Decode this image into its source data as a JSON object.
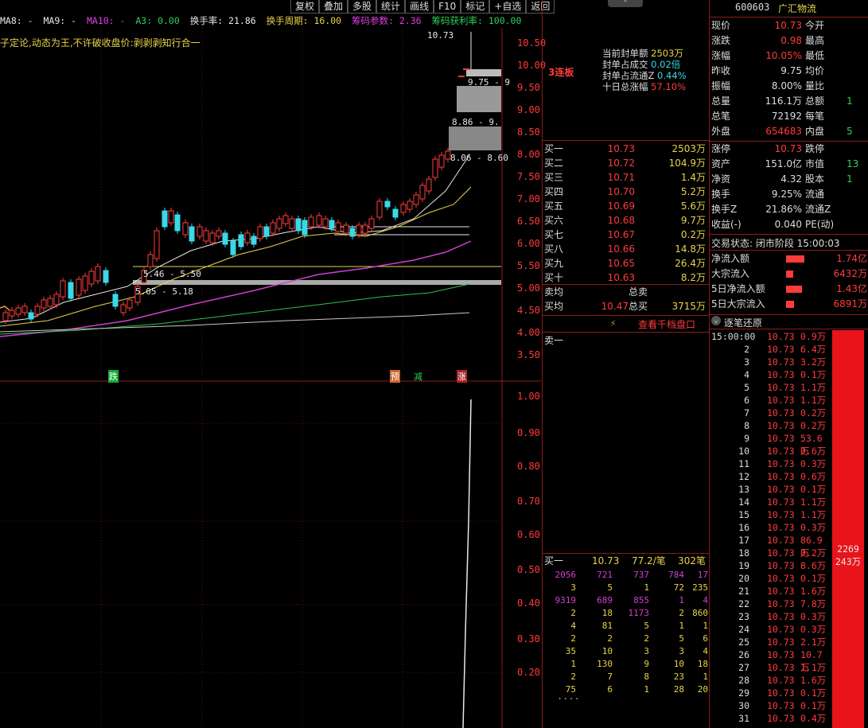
{
  "toolbar": [
    "复权",
    "叠加",
    "多股",
    "统计",
    "画线",
    "F10",
    "标记",
    "+自选",
    "返回"
  ],
  "indicator_bar": {
    "ma8": "MA8: -",
    "ma9": "MA9: -",
    "ma10": "MA10: -",
    "a3": "A3: 0.00",
    "turnover": "换手率: 21.86",
    "turnover_cycle": "换手周期: 16.00",
    "chip_param": "筹码参数: 2.36",
    "chip_profit": "筹码获利率: 100.00"
  },
  "motto": "子定论,动态为王,不许破收盘价:剥剥剥知行合一",
  "colors": {
    "up": "#ff3b3b",
    "down": "#38d9e8",
    "grid": "#8b1b1b"
  },
  "kline_axis": [
    "10.50",
    "10.00",
    "9.50",
    "9.00",
    "8.50",
    "8.00",
    "7.50",
    "7.00",
    "6.50",
    "6.00",
    "5.50",
    "5.00",
    "4.50",
    "4.00",
    "3.50"
  ],
  "price_labels": {
    "high": "10.73",
    "gap1": "9.75 - 9",
    "gap2": "8.86 - 9.",
    "gap3": "8.06 - 8.60",
    "zone1": "5.46 - 5.50",
    "zone2": "5.05 - 5.18"
  },
  "signals": {
    "die": "跌",
    "yu": "预",
    "jian": "减",
    "zhang": "涨"
  },
  "sub_axis": [
    "1.00",
    "0.90",
    "0.80",
    "0.70",
    "0.60",
    "0.50",
    "0.40",
    "0.30",
    "0.20"
  ],
  "center": {
    "streak": "3连板",
    "seal": [
      {
        "label": "当前封单额",
        "value": "2503万"
      },
      {
        "label": "封单占成交",
        "value": "0.02倍"
      },
      {
        "label": "封单占流通Z",
        "value": "0.44%"
      },
      {
        "label": "十日总涨幅",
        "value": "57.10%"
      }
    ],
    "bids": [
      {
        "name": "买一",
        "price": "10.73",
        "vol": "2503万"
      },
      {
        "name": "买二",
        "price": "10.72",
        "vol": "104.9万"
      },
      {
        "name": "买三",
        "price": "10.71",
        "vol": "1.4万"
      },
      {
        "name": "买四",
        "price": "10.70",
        "vol": "5.2万"
      },
      {
        "name": "买五",
        "price": "10.69",
        "vol": "5.6万"
      },
      {
        "name": "买六",
        "price": "10.68",
        "vol": "9.7万"
      },
      {
        "name": "买七",
        "price": "10.67",
        "vol": "0.2万"
      },
      {
        "name": "买八",
        "price": "10.66",
        "vol": "14.8万"
      },
      {
        "name": "买九",
        "price": "10.65",
        "vol": "26.4万"
      },
      {
        "name": "买十",
        "price": "10.63",
        "vol": "8.2万"
      }
    ],
    "sell_avg_label": "卖均",
    "total_sell_label": "总卖",
    "buy_avg_label": "买均",
    "buy_avg": "10.47",
    "total_buy_label": "总买",
    "total_buy": "3715万",
    "depth_button": "查看千档盘口",
    "sell1": "卖一",
    "buy1_row": {
      "label": "买一",
      "price": "10.73",
      "avg": "77.2/笔",
      "count": "302笔"
    },
    "queue": [
      [
        "2056",
        "721",
        "737",
        "784",
        "17"
      ],
      [
        "3",
        "5",
        "1",
        "72",
        "235"
      ],
      [
        "9319",
        "689",
        "855",
        "1",
        "4"
      ],
      [
        "2",
        "18",
        "1173",
        "2",
        "860"
      ],
      [
        "4",
        "81",
        "5",
        "1",
        "1"
      ],
      [
        "2",
        "2",
        "2",
        "5",
        "6"
      ],
      [
        "35",
        "10",
        "3",
        "3",
        "4"
      ],
      [
        "1",
        "130",
        "9",
        "10",
        "18"
      ],
      [
        "2",
        "7",
        "8",
        "23",
        "1"
      ],
      [
        "75",
        "6",
        "1",
        "28",
        "20"
      ]
    ],
    "more": "...."
  },
  "right": {
    "code": "600603",
    "name": "广汇物流",
    "quotes": [
      {
        "l1": "现价",
        "v1": "10.73",
        "l2": "今开",
        "v2": ""
      },
      {
        "l1": "涨跌",
        "v1": "0.98",
        "l2": "最高",
        "v2": ""
      },
      {
        "l1": "涨幅",
        "v1": "10.05%",
        "l2": "最低",
        "v2": ""
      },
      {
        "l1": "昨收",
        "v1": "9.75",
        "l2": "均价",
        "v2": ""
      },
      {
        "l1": "振幅",
        "v1": "8.00%",
        "l2": "量比",
        "v2": ""
      },
      {
        "l1": "总量",
        "v1": "116.1万",
        "l2": "总额",
        "v2": "1"
      },
      {
        "l1": "总笔",
        "v1": "72192",
        "l2": "每笔",
        "v2": ""
      },
      {
        "l1": "外盘",
        "v1": "654683",
        "l2": "内盘",
        "v2": "5"
      }
    ],
    "quotes2": [
      {
        "l1": "涨停",
        "v1": "10.73",
        "l2": "跌停",
        "v2": ""
      },
      {
        "l1": "资产",
        "v1": "151.0亿",
        "l2": "市值",
        "v2": "13"
      },
      {
        "l1": "净资",
        "v1": "4.32",
        "l2": "股本",
        "v2": "1"
      },
      {
        "l1": "换手",
        "v1": "9.25%",
        "l2": "流通",
        "v2": ""
      },
      {
        "l1": "换手Z",
        "v1": "21.86%",
        "l2": "流通Z",
        "v2": ""
      },
      {
        "l1": "收益(-)",
        "v1": "0.040",
        "l2": "PE(动)",
        "v2": ""
      }
    ],
    "trade_status": "交易状态: 闭市阶段 15:00:03",
    "flows": [
      {
        "label": "净流入额",
        "value": "1.74亿",
        "bar": 0.9
      },
      {
        "label": "大宗流入",
        "value": "6432万",
        "bar": 0.35
      },
      {
        "label": "5日净流入额",
        "value": "1.43亿",
        "bar": 0.75
      },
      {
        "label": "5日大宗流入",
        "value": "6891万",
        "bar": 0.38
      }
    ],
    "tick_title": "逐笔还原",
    "ticks": [
      {
        "t": "15:00:00",
        "p": "10.73",
        "a": "0.9万"
      },
      {
        "t": "2",
        "p": "10.73",
        "a": "6.4万"
      },
      {
        "t": "3",
        "p": "10.73",
        "a": "3.2万"
      },
      {
        "t": "4",
        "p": "10.73",
        "a": "0.1万"
      },
      {
        "t": "5",
        "p": "10.73",
        "a": "1.1万"
      },
      {
        "t": "6",
        "p": "10.73",
        "a": "1.1万"
      },
      {
        "t": "7",
        "p": "10.73",
        "a": "0.2万"
      },
      {
        "t": "8",
        "p": "10.73",
        "a": "0.2万"
      },
      {
        "t": "9",
        "p": "10.73",
        "a": "53.6万"
      },
      {
        "t": "10",
        "p": "10.73",
        "a": "0.6万"
      },
      {
        "t": "11",
        "p": "10.73",
        "a": "0.3万"
      },
      {
        "t": "12",
        "p": "10.73",
        "a": "0.6万"
      },
      {
        "t": "13",
        "p": "10.73",
        "a": "0.1万"
      },
      {
        "t": "14",
        "p": "10.73",
        "a": "1.1万"
      },
      {
        "t": "15",
        "p": "10.73",
        "a": "1.1万"
      },
      {
        "t": "16",
        "p": "10.73",
        "a": "0.3万"
      },
      {
        "t": "17",
        "p": "10.73",
        "a": "86.9万"
      },
      {
        "t": "18",
        "p": "10.73",
        "a": "0.2万"
      },
      {
        "t": "19",
        "p": "10.73",
        "a": "8.6万"
      },
      {
        "t": "20",
        "p": "10.73",
        "a": "0.1万"
      },
      {
        "t": "21",
        "p": "10.73",
        "a": "1.6万"
      },
      {
        "t": "22",
        "p": "10.73",
        "a": "7.8万"
      },
      {
        "t": "23",
        "p": "10.73",
        "a": "0.3万"
      },
      {
        "t": "24",
        "p": "10.73",
        "a": "0.3万"
      },
      {
        "t": "25",
        "p": "10.73",
        "a": "2.1万"
      },
      {
        "t": "26",
        "p": "10.73",
        "a": "10.7万"
      },
      {
        "t": "27",
        "p": "10.73",
        "a": "1.1万"
      },
      {
        "t": "28",
        "p": "10.73",
        "a": "1.6万"
      },
      {
        "t": "29",
        "p": "10.73",
        "a": "0.1万"
      },
      {
        "t": "30",
        "p": "10.73",
        "a": "0.1万"
      },
      {
        "t": "31",
        "p": "10.73",
        "a": "0.4万"
      }
    ],
    "bar_value1": "2269",
    "bar_value2": "243万"
  }
}
